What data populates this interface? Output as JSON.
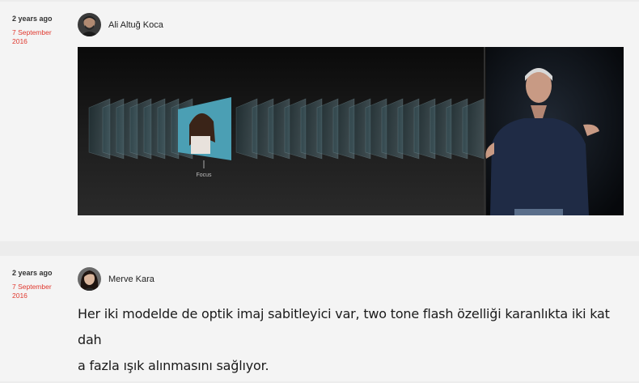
{
  "posts": [
    {
      "time_ago": "2 years ago",
      "date_line1": "7 September",
      "date_line2": "2016",
      "author": "Ali Altuğ Koca",
      "media": {
        "caption": "Focus"
      }
    },
    {
      "time_ago": "2 years ago",
      "date_line1": "7 September",
      "date_line2": "2016",
      "author": "Merve Kara",
      "comment_line1": "Her iki modelde de optik imaj sabitleyici var, two tone flash özelliği karanlıkta iki kat dah",
      "comment_line2": "a fazla ışık alınmasını sağlıyor."
    }
  ],
  "colors": {
    "date": "#e0392f",
    "background": "#f4f4f4",
    "divider": "#ececec"
  }
}
